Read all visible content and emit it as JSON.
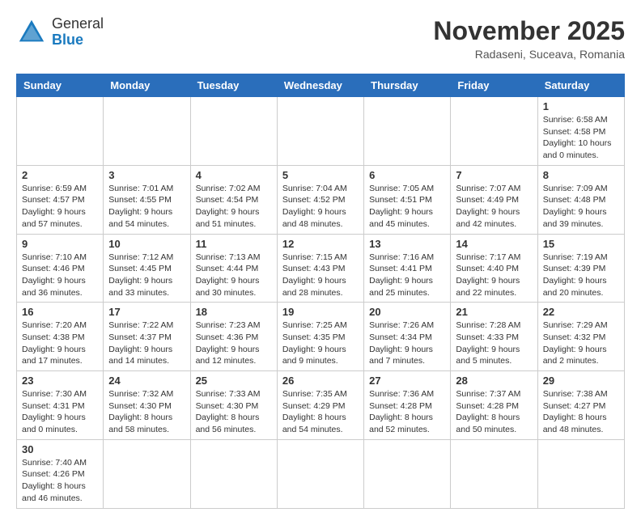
{
  "header": {
    "logo_general": "General",
    "logo_blue": "Blue",
    "month_title": "November 2025",
    "location": "Radaseni, Suceava, Romania"
  },
  "days_of_week": [
    "Sunday",
    "Monday",
    "Tuesday",
    "Wednesday",
    "Thursday",
    "Friday",
    "Saturday"
  ],
  "weeks": [
    [
      {
        "day": "",
        "info": ""
      },
      {
        "day": "",
        "info": ""
      },
      {
        "day": "",
        "info": ""
      },
      {
        "day": "",
        "info": ""
      },
      {
        "day": "",
        "info": ""
      },
      {
        "day": "",
        "info": ""
      },
      {
        "day": "1",
        "info": "Sunrise: 6:58 AM\nSunset: 4:58 PM\nDaylight: 10 hours\nand 0 minutes."
      }
    ],
    [
      {
        "day": "2",
        "info": "Sunrise: 6:59 AM\nSunset: 4:57 PM\nDaylight: 9 hours\nand 57 minutes."
      },
      {
        "day": "3",
        "info": "Sunrise: 7:01 AM\nSunset: 4:55 PM\nDaylight: 9 hours\nand 54 minutes."
      },
      {
        "day": "4",
        "info": "Sunrise: 7:02 AM\nSunset: 4:54 PM\nDaylight: 9 hours\nand 51 minutes."
      },
      {
        "day": "5",
        "info": "Sunrise: 7:04 AM\nSunset: 4:52 PM\nDaylight: 9 hours\nand 48 minutes."
      },
      {
        "day": "6",
        "info": "Sunrise: 7:05 AM\nSunset: 4:51 PM\nDaylight: 9 hours\nand 45 minutes."
      },
      {
        "day": "7",
        "info": "Sunrise: 7:07 AM\nSunset: 4:49 PM\nDaylight: 9 hours\nand 42 minutes."
      },
      {
        "day": "8",
        "info": "Sunrise: 7:09 AM\nSunset: 4:48 PM\nDaylight: 9 hours\nand 39 minutes."
      }
    ],
    [
      {
        "day": "9",
        "info": "Sunrise: 7:10 AM\nSunset: 4:46 PM\nDaylight: 9 hours\nand 36 minutes."
      },
      {
        "day": "10",
        "info": "Sunrise: 7:12 AM\nSunset: 4:45 PM\nDaylight: 9 hours\nand 33 minutes."
      },
      {
        "day": "11",
        "info": "Sunrise: 7:13 AM\nSunset: 4:44 PM\nDaylight: 9 hours\nand 30 minutes."
      },
      {
        "day": "12",
        "info": "Sunrise: 7:15 AM\nSunset: 4:43 PM\nDaylight: 9 hours\nand 28 minutes."
      },
      {
        "day": "13",
        "info": "Sunrise: 7:16 AM\nSunset: 4:41 PM\nDaylight: 9 hours\nand 25 minutes."
      },
      {
        "day": "14",
        "info": "Sunrise: 7:17 AM\nSunset: 4:40 PM\nDaylight: 9 hours\nand 22 minutes."
      },
      {
        "day": "15",
        "info": "Sunrise: 7:19 AM\nSunset: 4:39 PM\nDaylight: 9 hours\nand 20 minutes."
      }
    ],
    [
      {
        "day": "16",
        "info": "Sunrise: 7:20 AM\nSunset: 4:38 PM\nDaylight: 9 hours\nand 17 minutes."
      },
      {
        "day": "17",
        "info": "Sunrise: 7:22 AM\nSunset: 4:37 PM\nDaylight: 9 hours\nand 14 minutes."
      },
      {
        "day": "18",
        "info": "Sunrise: 7:23 AM\nSunset: 4:36 PM\nDaylight: 9 hours\nand 12 minutes."
      },
      {
        "day": "19",
        "info": "Sunrise: 7:25 AM\nSunset: 4:35 PM\nDaylight: 9 hours\nand 9 minutes."
      },
      {
        "day": "20",
        "info": "Sunrise: 7:26 AM\nSunset: 4:34 PM\nDaylight: 9 hours\nand 7 minutes."
      },
      {
        "day": "21",
        "info": "Sunrise: 7:28 AM\nSunset: 4:33 PM\nDaylight: 9 hours\nand 5 minutes."
      },
      {
        "day": "22",
        "info": "Sunrise: 7:29 AM\nSunset: 4:32 PM\nDaylight: 9 hours\nand 2 minutes."
      }
    ],
    [
      {
        "day": "23",
        "info": "Sunrise: 7:30 AM\nSunset: 4:31 PM\nDaylight: 9 hours\nand 0 minutes."
      },
      {
        "day": "24",
        "info": "Sunrise: 7:32 AM\nSunset: 4:30 PM\nDaylight: 8 hours\nand 58 minutes."
      },
      {
        "day": "25",
        "info": "Sunrise: 7:33 AM\nSunset: 4:30 PM\nDaylight: 8 hours\nand 56 minutes."
      },
      {
        "day": "26",
        "info": "Sunrise: 7:35 AM\nSunset: 4:29 PM\nDaylight: 8 hours\nand 54 minutes."
      },
      {
        "day": "27",
        "info": "Sunrise: 7:36 AM\nSunset: 4:28 PM\nDaylight: 8 hours\nand 52 minutes."
      },
      {
        "day": "28",
        "info": "Sunrise: 7:37 AM\nSunset: 4:28 PM\nDaylight: 8 hours\nand 50 minutes."
      },
      {
        "day": "29",
        "info": "Sunrise: 7:38 AM\nSunset: 4:27 PM\nDaylight: 8 hours\nand 48 minutes."
      }
    ],
    [
      {
        "day": "30",
        "info": "Sunrise: 7:40 AM\nSunset: 4:26 PM\nDaylight: 8 hours\nand 46 minutes."
      },
      {
        "day": "",
        "info": ""
      },
      {
        "day": "",
        "info": ""
      },
      {
        "day": "",
        "info": ""
      },
      {
        "day": "",
        "info": ""
      },
      {
        "day": "",
        "info": ""
      },
      {
        "day": "",
        "info": ""
      }
    ]
  ]
}
